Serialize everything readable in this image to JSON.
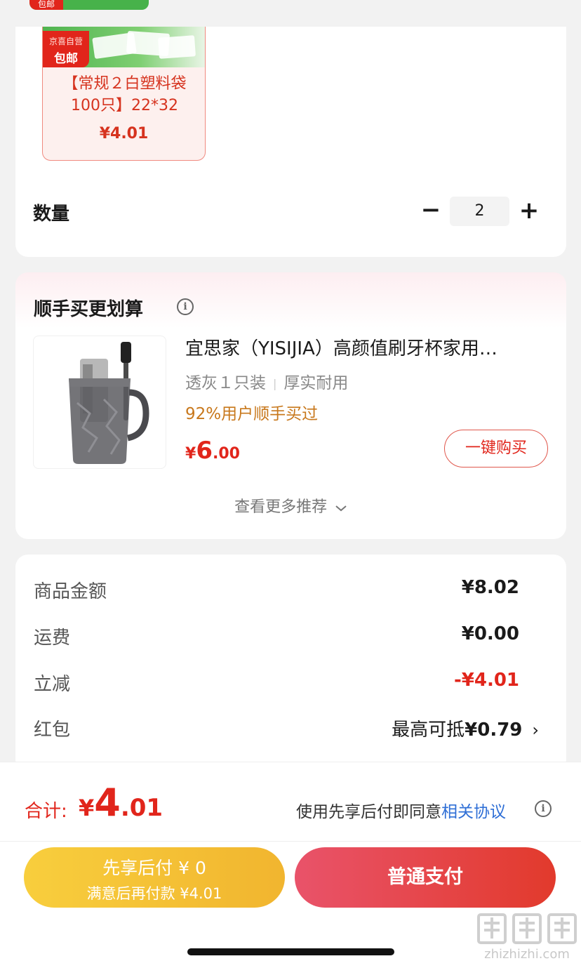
{
  "top_tag": {
    "label": "包邮"
  },
  "gift": {
    "badge_line1": "京喜自营",
    "badge_line2": "包邮",
    "title": "【常规２白塑料袋100只】22*32",
    "price": "¥4.01"
  },
  "quantity": {
    "label": "数量",
    "minus": "−",
    "value": "2",
    "plus": "+"
  },
  "recommend": {
    "title": "顺手买更划算",
    "info_icon": "i",
    "product": {
      "image_icon": "toothbrush-cup",
      "name": "宜思家（YISIJIA）高颜值刷牙杯家用…",
      "spec1": "透灰１只装",
      "spec_sep": "|",
      "spec2": "厚实耐用",
      "bought": "92%用户顺手买过",
      "price_currency": "¥",
      "price_int": "6",
      "price_dec": ".00",
      "buy_label": "一键购买"
    },
    "more_label": "查看更多推荐",
    "more_icon": "chevron-down"
  },
  "summary": {
    "rows": [
      {
        "label": "商品金额",
        "value": "¥8.02"
      },
      {
        "label": "运费",
        "value": "¥0.00"
      },
      {
        "label": "立减",
        "value": "-¥4.01"
      },
      {
        "label": "红包",
        "value_prefix": "最高可抵",
        "value": "¥0.79",
        "arrow": "›"
      }
    ]
  },
  "footer": {
    "total_label": "合计:",
    "total_currency": "¥",
    "total_int": "4",
    "total_dec": ".01",
    "agree_text": "使用先享后付即同意",
    "agree_link": "相关协议",
    "pay_later_line1": "先享后付 ¥ 0",
    "pay_later_line2": "满意后再付款 ¥4.01",
    "pay_normal": "普通支付"
  },
  "watermark": {
    "text": "zhizhizhi.com"
  },
  "colors": {
    "accent_red": "#e1251b",
    "link_blue": "#2f6fd6",
    "bought_orange": "#c8781c",
    "pay_later_yellow": "#f5c338"
  }
}
